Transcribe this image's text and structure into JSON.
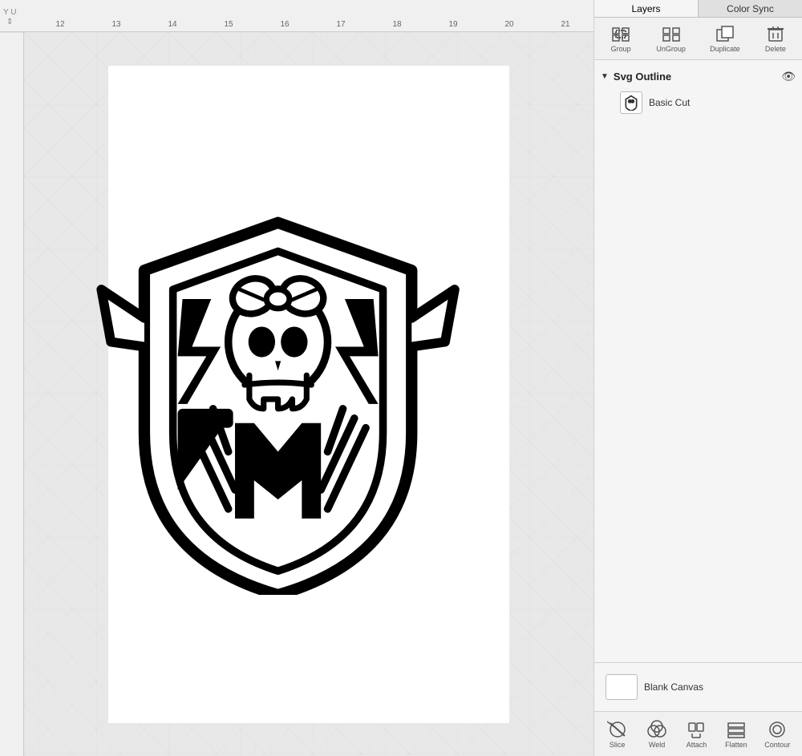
{
  "tabs": [
    {
      "id": "layers",
      "label": "Layers",
      "active": true
    },
    {
      "id": "color-sync",
      "label": "Color Sync",
      "active": false
    }
  ],
  "toolbar": {
    "buttons": [
      {
        "id": "group",
        "label": "Group",
        "icon": "⊞",
        "disabled": false
      },
      {
        "id": "ungroup",
        "label": "UnGroup",
        "icon": "⊟",
        "disabled": false
      },
      {
        "id": "duplicate",
        "label": "Duplicate",
        "icon": "❑",
        "disabled": false
      },
      {
        "id": "delete",
        "label": "Delete",
        "icon": "✕",
        "disabled": false
      }
    ]
  },
  "svg_outline": {
    "title": "Svg Outline",
    "visible": true,
    "items": [
      {
        "id": "basic-cut",
        "name": "Basic Cut",
        "thumb": "🛡"
      }
    ]
  },
  "blank_canvas": {
    "label": "Blank Canvas"
  },
  "bottom_toolbar": {
    "buttons": [
      {
        "id": "slice",
        "label": "Slice",
        "icon": "✂"
      },
      {
        "id": "weld",
        "label": "Weld",
        "icon": "⊕"
      },
      {
        "id": "attach",
        "label": "Attach",
        "icon": "📎"
      },
      {
        "id": "flatten",
        "label": "Flatten",
        "icon": "▦"
      },
      {
        "id": "contour",
        "label": "Contour",
        "icon": "◎"
      }
    ]
  },
  "ruler": {
    "marks": [
      "12",
      "13",
      "14",
      "15",
      "16",
      "17",
      "18",
      "19",
      "20",
      "21"
    ]
  },
  "tool_corner": "Y U"
}
